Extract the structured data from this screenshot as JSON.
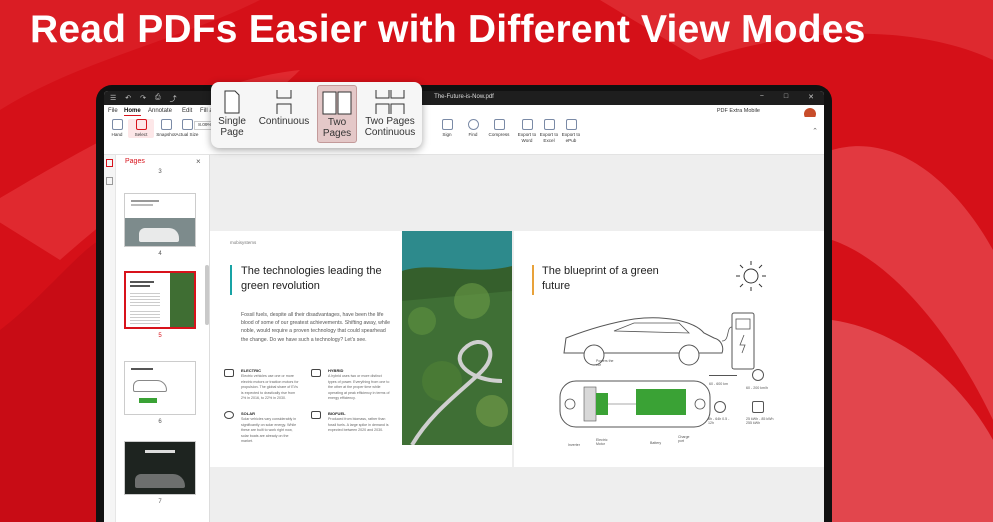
{
  "headline": "Read PDFs Easier with Different View Modes",
  "window": {
    "title": "The-Future-is-Now.pdf",
    "brand": "PDF Extra Mobile",
    "win_min": "−",
    "win_max": "□",
    "win_close": "✕"
  },
  "menu": {
    "file": "File",
    "home": "Home",
    "annotate": "Annotate",
    "edit": "Edit",
    "fill": "Fill a"
  },
  "ribbon": {
    "hand": "Hand",
    "select": "Select",
    "snapshot": "Snapshot",
    "actual_size": "Actual Size",
    "zoom": "8.09%",
    "sign": "Sign",
    "find": "Find",
    "compress": "Compress",
    "export_word": "Export to Word",
    "export_excel": "Export to Excel",
    "export_epub": "Export to ePub"
  },
  "view_modes": {
    "single": "Single Page",
    "continuous": "Continuous",
    "two_pages": "Two Pages",
    "two_pages_continuous": "Two Pages Continuous"
  },
  "pages_panel": {
    "title": "Pages",
    "close": "×",
    "thumbs": [
      {
        "num": "3"
      },
      {
        "num": "4"
      },
      {
        "num": "5"
      },
      {
        "num": "6"
      },
      {
        "num": "7"
      }
    ]
  },
  "left_page": {
    "logo": "mobisystems",
    "title": "The technologies leading the green revolution",
    "body": "Fossil fuels, despite all their disadvantages, have been the life blood of some of our greatest achievements. Shifting away, while noble, would require a proven technology that could spearhead the change. Do we have such a technology? Let's see.",
    "items": [
      {
        "title": "ELECTRIC",
        "text": "Electric vehicles use one or more electric motors or traction motors for propulsion. The global share of EVs is expected to drastically rise from 2% in 2016, to 22% in 2030."
      },
      {
        "title": "HYBRID",
        "text": "A hybrid uses two or more distinct types of power. Everything from one to the other at the proper time while operating at peak efficiency in terms of energy efficiency."
      },
      {
        "title": "SOLAR",
        "text": "Solar vehicles vary considerably in significantly on solar energy. While these are built to work right now, solar boats are already on the market."
      },
      {
        "title": "BIOFUEL",
        "text": "Produced from biomass, rather than fossil fuels. A large spike in demand is expected between 2020 and 2030."
      }
    ]
  },
  "right_page": {
    "title": "The blueprint of a green future",
    "labels": {
      "power_car": "Powers the car",
      "inverter": "Inverter",
      "electric_motor": "Electric Motor",
      "battery": "Battery",
      "charge_port": "Charge port",
      "range": "60 - 600 km",
      "speed": "60 - 200 km/h",
      "charge_time": "8h - 64h 0.5 - 12h",
      "power": "25 kWh - 85 kWh 255 kWh"
    }
  },
  "colors": {
    "accent": "#d8121b",
    "green": "#3aa235",
    "teal": "#18a3a5",
    "orange": "#e8a23a"
  }
}
